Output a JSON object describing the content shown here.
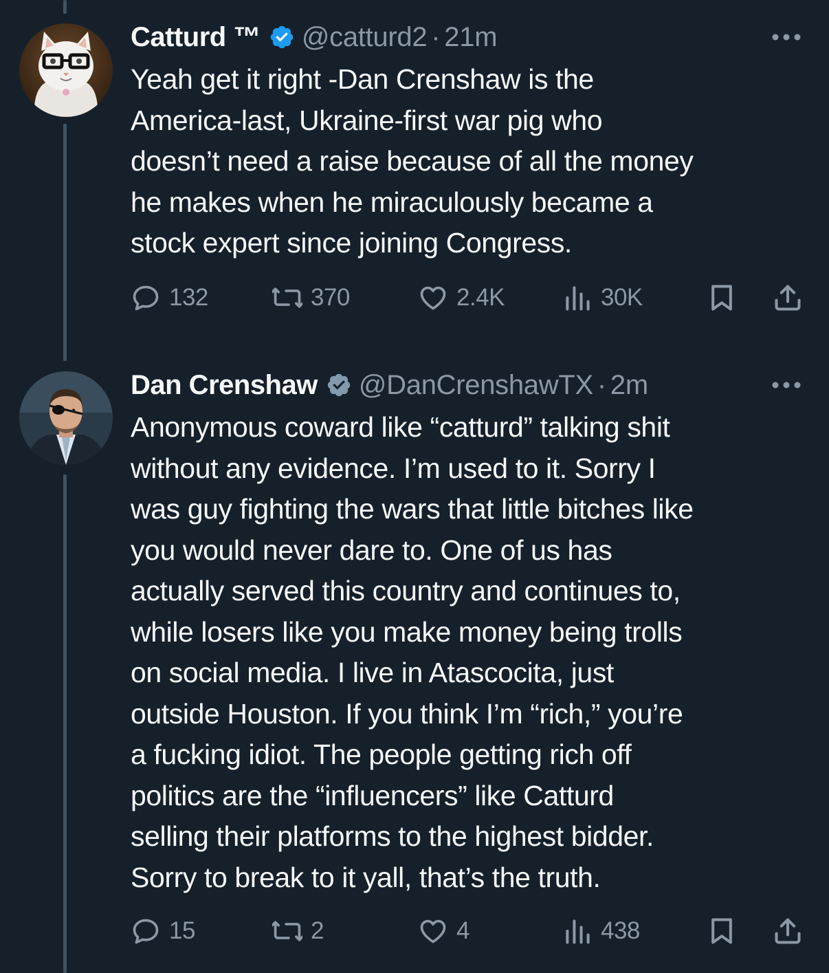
{
  "tweets": [
    {
      "name": "Catturd ™",
      "handle": "@catturd2",
      "separator": "·",
      "time": "21m",
      "text": "Yeah get it right -Dan Crenshaw is the\nAmerica-last, Ukraine-first war pig who\ndoesn’t need a raise because of all the money\nhe makes when he miraculously became a\nstock expert since joining Congress.",
      "replies": "132",
      "retweets": "370",
      "likes": "2.4K",
      "views": "30K",
      "avatar": "cat-with-glasses-avatar",
      "verified_color": "#1d9bf0"
    },
    {
      "name": "Dan Crenshaw",
      "handle": "@DanCrenshawTX",
      "separator": "·",
      "time": "2m",
      "text": "Anonymous coward like “catturd” talking shit\nwithout any evidence. I’m used to it. Sorry I\nwas guy fighting the wars that little bitches like\nyou would never dare to. One of us has\nactually served this country and continues to,\nwhile losers like you make money being trolls\non social media. I live in Atascocita, just\noutside Houston. If you think I’m “rich,” you’re\na fucking idiot. The people getting rich off\npolitics are the “influencers” like Catturd\nselling their platforms to the highest bidder.\nSorry to break to it yall, that’s the truth.",
      "replies": "15",
      "retweets": "2",
      "likes": "4",
      "views": "438",
      "avatar": "man-with-eyepatch-avatar",
      "verified_color": "#829aab"
    }
  ],
  "colors": {
    "background": "#15202b",
    "text": "#f7f9f9",
    "muted": "#8b98a5",
    "thread_line": "#3d5466"
  },
  "icons": [
    "reply-icon",
    "retweet-icon",
    "like-icon",
    "views-icon",
    "bookmark-icon",
    "share-icon",
    "more-icon",
    "verified-badge-icon"
  ]
}
